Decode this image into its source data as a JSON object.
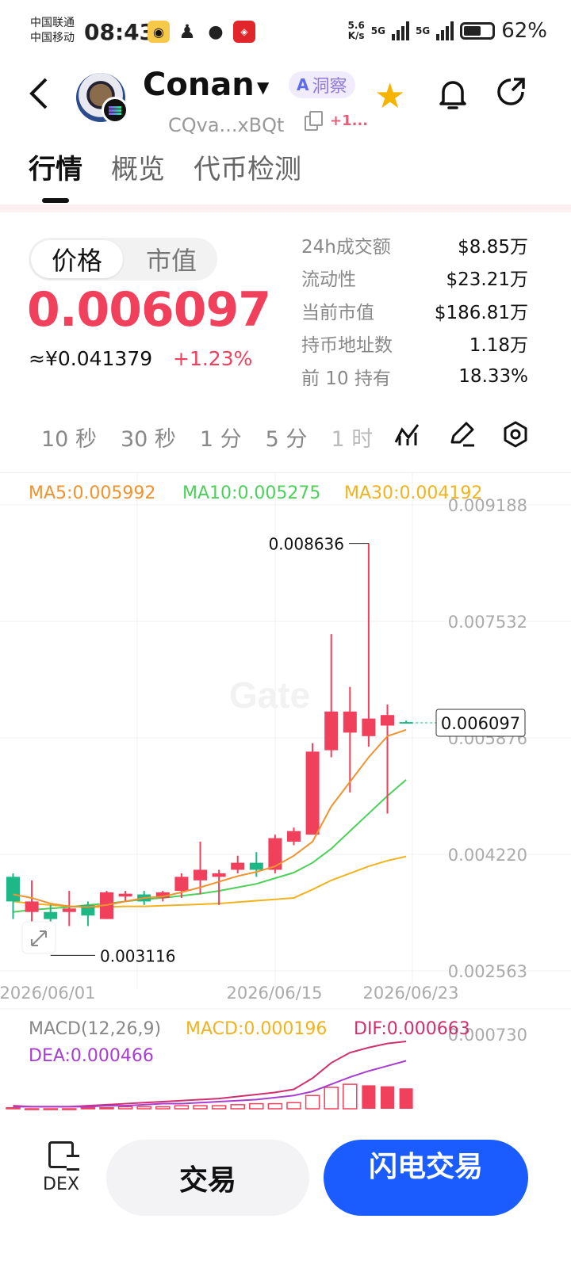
{
  "status_bar": {
    "carrier1": "中国联通",
    "carrier2": "中国移动",
    "time": "08:43",
    "net_speed_value": "5.6",
    "net_speed_unit": "K/s",
    "signal1": "5G",
    "signal2": "5G",
    "battery": "62%",
    "battery_level": 0.62
  },
  "header": {
    "token_name": "Conan",
    "ai_label": "洞察",
    "address": "CQva...xBQt",
    "extra": "+1..."
  },
  "tabs": [
    "行情",
    "概览",
    "代币检测"
  ],
  "price_toggle": [
    "价格",
    "市值"
  ],
  "price": {
    "value": "0.006097",
    "cny": "≈¥0.041379",
    "change": "+1.23%"
  },
  "stats": [
    {
      "label": "24h成交额",
      "value": "$8.85万"
    },
    {
      "label": "流动性",
      "value": "$23.21万"
    },
    {
      "label": "当前市值",
      "value": "$186.81万"
    },
    {
      "label": "持币地址数",
      "value": "1.18万"
    },
    {
      "label": "前 10 持有",
      "value": "18.33%"
    }
  ],
  "intervals": [
    "10 秒",
    "30 秒",
    "1 分",
    "5 分",
    "1 时"
  ],
  "colors": {
    "up": "#f0405c",
    "down": "#1db885",
    "ma5": "#f0922e",
    "ma10": "#4cd05a",
    "ma30": "#f0b31e",
    "macd": "#f0b31e",
    "dif": "#d0306e",
    "dea": "#a83ed0",
    "brand_blue": "#1a5cff"
  },
  "chart_data": {
    "type": "candlestick",
    "watermark": "Gate",
    "legend": {
      "ma5": "MA5:0.005992",
      "ma10": "MA10:0.005275",
      "ma30": "MA30:0.004192"
    },
    "y_ticks": [
      "0.009188",
      "0.007532",
      "0.005876",
      "0.004220",
      "0.002563"
    ],
    "y_range": [
      0.002563,
      0.009188
    ],
    "x_labels": [
      "2026/06/01",
      "2026/06/15",
      "2026/06/23"
    ],
    "max_label": "0.008636",
    "min_label": "0.003116",
    "current_label": "0.006097",
    "candles": [
      {
        "o": 0.0039,
        "h": 0.00395,
        "c": 0.00355,
        "l": 0.0033
      },
      {
        "o": 0.0034,
        "h": 0.00385,
        "c": 0.00355,
        "l": 0.0032
      },
      {
        "o": 0.0034,
        "h": 0.0035,
        "c": 0.0033,
        "l": 0.0031
      },
      {
        "o": 0.0034,
        "h": 0.0037,
        "c": 0.00345,
        "l": 0.0032
      },
      {
        "o": 0.0035,
        "h": 0.00355,
        "c": 0.00335,
        "l": 0.0032
      },
      {
        "o": 0.0033,
        "h": 0.0037,
        "c": 0.00368,
        "l": 0.0033
      },
      {
        "o": 0.00362,
        "h": 0.0037,
        "c": 0.00366,
        "l": 0.00355
      },
      {
        "o": 0.00365,
        "h": 0.0037,
        "c": 0.00355,
        "l": 0.0035
      },
      {
        "o": 0.0036,
        "h": 0.0037,
        "c": 0.00368,
        "l": 0.00355
      },
      {
        "o": 0.0037,
        "h": 0.00395,
        "c": 0.0039,
        "l": 0.0036
      },
      {
        "o": 0.00385,
        "h": 0.0044,
        "c": 0.004,
        "l": 0.00365
      },
      {
        "o": 0.0039,
        "h": 0.004,
        "c": 0.00395,
        "l": 0.0035
      },
      {
        "o": 0.004,
        "h": 0.0042,
        "c": 0.0041,
        "l": 0.00395
      },
      {
        "o": 0.0041,
        "h": 0.00425,
        "c": 0.004,
        "l": 0.0039
      },
      {
        "o": 0.004,
        "h": 0.0045,
        "c": 0.00445,
        "l": 0.00395
      },
      {
        "o": 0.0044,
        "h": 0.0046,
        "c": 0.00455,
        "l": 0.00435
      },
      {
        "o": 0.0045,
        "h": 0.0058,
        "c": 0.00568,
        "l": 0.0045
      },
      {
        "o": 0.0057,
        "h": 0.00735,
        "c": 0.00625,
        "l": 0.0056
      },
      {
        "o": 0.00595,
        "h": 0.0066,
        "c": 0.00625,
        "l": 0.0051
      },
      {
        "o": 0.0059,
        "h": 0.00864,
        "c": 0.00615,
        "l": 0.00575
      },
      {
        "o": 0.00605,
        "h": 0.00635,
        "c": 0.0062,
        "l": 0.0048
      },
      {
        "o": 0.0061,
        "h": 0.00612,
        "c": 0.00609,
        "l": 0.00608
      }
    ],
    "ma5": [
      0.00365,
      0.0036,
      0.00352,
      0.00348,
      0.00347,
      0.0035,
      0.00355,
      0.0036,
      0.00362,
      0.00368,
      0.00375,
      0.00383,
      0.00391,
      0.00397,
      0.00405,
      0.0042,
      0.0044,
      0.0049,
      0.00525,
      0.0056,
      0.0059,
      0.00599
    ],
    "ma10": [
      0.0034,
      0.00343,
      0.00345,
      0.00347,
      0.0035,
      0.00352,
      0.00355,
      0.00358,
      0.0036,
      0.00363,
      0.00366,
      0.0037,
      0.00375,
      0.0038,
      0.00388,
      0.00396,
      0.0041,
      0.0043,
      0.00455,
      0.0048,
      0.00505,
      0.00528
    ],
    "ma30": [
      0.00355,
      0.00352,
      0.0035,
      0.00348,
      0.00347,
      0.00347,
      0.00348,
      0.00348,
      0.00349,
      0.0035,
      0.00351,
      0.00352,
      0.00354,
      0.00356,
      0.00358,
      0.0036,
      0.00372,
      0.00385,
      0.00395,
      0.00405,
      0.00413,
      0.00419
    ],
    "macd": {
      "legend_macd": "MACD(12,26,9)",
      "legend_macd_value": "MACD:0.000196",
      "legend_dif": "DIF:0.000663",
      "legend_dea": "DEA:0.000466",
      "y_tick": "0.000730",
      "dif": [
        3e-05,
        2e-05,
        2e-05,
        2e-05,
        3e-05,
        4e-05,
        5e-05,
        6e-05,
        7e-05,
        8e-05,
        9e-05,
        0.0001,
        0.00012,
        0.00014,
        0.00016,
        0.00019,
        0.0003,
        0.00045,
        0.00055,
        0.0006,
        0.00064,
        0.00066
      ],
      "dea": [
        2e-05,
        2e-05,
        2e-05,
        2e-05,
        2e-05,
        3e-05,
        3e-05,
        4e-05,
        5e-05,
        5e-05,
        6e-05,
        7e-05,
        8e-05,
        9e-05,
        0.00011,
        0.00013,
        0.00017,
        0.00024,
        0.00031,
        0.00037,
        0.00042,
        0.00047
      ],
      "hist": [
        1e-05,
        0.0,
        0.0,
        0.0,
        1e-05,
        1e-05,
        2e-05,
        2e-05,
        2e-05,
        3e-05,
        3e-05,
        3e-05,
        4e-05,
        5e-05,
        5e-05,
        6e-05,
        0.00013,
        0.00021,
        0.00024,
        0.00023,
        0.00022,
        0.0002
      ]
    }
  },
  "bottom_bar": {
    "dex_label": "DEX",
    "trade_label": "交易",
    "flash_trade_label": "闪电交易"
  }
}
